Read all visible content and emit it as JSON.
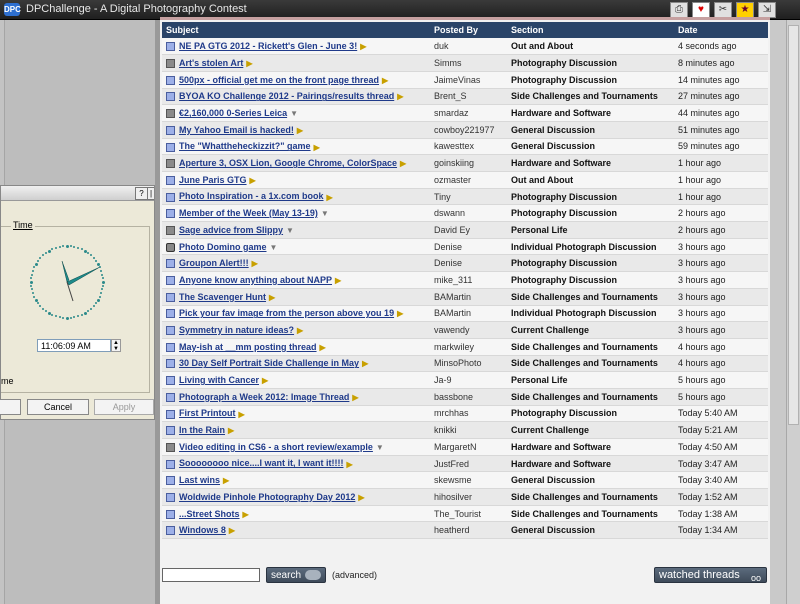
{
  "window": {
    "title": "DPChallenge - A Digital Photography Contest",
    "logo_text": "DPC"
  },
  "table": {
    "headers": {
      "subject": "Subject",
      "posted_by": "Posted By",
      "section": "Section",
      "date": "Date"
    },
    "rows": [
      {
        "subject": "NE PA GTG 2012 - Rickett's Glen - June 3!",
        "poster": "duk",
        "section": "Out and About",
        "date": "4 seconds ago",
        "icon": "blue",
        "arrow": "right"
      },
      {
        "subject": "Art's stolen Art",
        "poster": "Simms",
        "section": "Photography Discussion",
        "date": "8 minutes ago",
        "icon": "gray",
        "arrow": "right"
      },
      {
        "subject": "500px - official get me on the front page thread",
        "poster": "JaimeVinas",
        "section": "Photography Discussion",
        "date": "14 minutes ago",
        "icon": "blue",
        "arrow": "right"
      },
      {
        "subject": "BYOA KO Challenge 2012 - Pairings/results thread",
        "poster": "Brent_S",
        "section": "Side Challenges and Tournaments",
        "date": "27 minutes ago",
        "icon": "blue",
        "arrow": "right"
      },
      {
        "subject": "€2,160,000 0-Series Leica",
        "poster": "smardaz",
        "section": "Hardware and Software",
        "date": "44 minutes ago",
        "icon": "gray",
        "arrow": "down"
      },
      {
        "subject": "My Yahoo Email is hacked!",
        "poster": "cowboy221977",
        "section": "General Discussion",
        "date": "51 minutes ago",
        "icon": "blue",
        "arrow": "right"
      },
      {
        "subject": "The \"Whattheheckizzit?\" game",
        "poster": "kawesttex",
        "section": "General Discussion",
        "date": "59 minutes ago",
        "icon": "blue",
        "arrow": "right"
      },
      {
        "subject": "Aperture 3, OSX Lion, Google Chrome, ColorSpace",
        "poster": "goinskiing",
        "section": "Hardware and Software",
        "date": "1 hour ago",
        "icon": "gray",
        "arrow": "right"
      },
      {
        "subject": "June Paris GTG",
        "poster": "ozmaster",
        "section": "Out and About",
        "date": "1 hour ago",
        "icon": "blue",
        "arrow": "right"
      },
      {
        "subject": "Photo Inspiration - a 1x.com book",
        "poster": "Tiny",
        "section": "Photography Discussion",
        "date": "1 hour ago",
        "icon": "blue",
        "arrow": "right"
      },
      {
        "subject": "Member of the Week (May 13-19)",
        "poster": "dswann",
        "section": "Photography Discussion",
        "date": "2 hours ago",
        "icon": "blue",
        "arrow": "down"
      },
      {
        "subject": "Sage advice from Slippy",
        "poster": "David Ey",
        "section": "Personal Life",
        "date": "2 hours ago",
        "icon": "gray",
        "arrow": "down"
      },
      {
        "subject": "Photo Domino game",
        "poster": "Denise",
        "section": "Individual Photograph Discussion",
        "date": "3 hours ago",
        "icon": "camera",
        "arrow": "down"
      },
      {
        "subject": "Groupon Alert!!!",
        "poster": "Denise",
        "section": "Photography Discussion",
        "date": "3 hours ago",
        "icon": "blue",
        "arrow": "right"
      },
      {
        "subject": "Anyone know anything about NAPP",
        "poster": "mike_311",
        "section": "Photography Discussion",
        "date": "3 hours ago",
        "icon": "blue",
        "arrow": "right"
      },
      {
        "subject": "The Scavenger Hunt",
        "poster": "BAMartin",
        "section": "Side Challenges and Tournaments",
        "date": "3 hours ago",
        "icon": "blue",
        "arrow": "right"
      },
      {
        "subject": "Pick your fav image from the person above you 19",
        "poster": "BAMartin",
        "section": "Individual Photograph Discussion",
        "date": "3 hours ago",
        "icon": "blue",
        "arrow": "right"
      },
      {
        "subject": "Symmetry in nature ideas?",
        "poster": "vawendy",
        "section": "Current Challenge",
        "date": "3 hours ago",
        "icon": "blue",
        "arrow": "right"
      },
      {
        "subject": "May-ish at __mm posting thread",
        "poster": "markwiley",
        "section": "Side Challenges and Tournaments",
        "date": "4 hours ago",
        "icon": "blue",
        "arrow": "right"
      },
      {
        "subject": "30 Day Self Portrait Side Challenge in May",
        "poster": "MinsoPhoto",
        "section": "Side Challenges and Tournaments",
        "date": "4 hours ago",
        "icon": "blue",
        "arrow": "right"
      },
      {
        "subject": "Living with Cancer",
        "poster": "Ja-9",
        "section": "Personal Life",
        "date": "5 hours ago",
        "icon": "blue",
        "arrow": "right"
      },
      {
        "subject": "Photograph a Week 2012: Image Thread",
        "poster": "bassbone",
        "section": "Side Challenges and Tournaments",
        "date": "5 hours ago",
        "icon": "blue",
        "arrow": "right"
      },
      {
        "subject": "First Printout",
        "poster": "mrchhas",
        "section": "Photography Discussion",
        "date": "Today 5:40 AM",
        "icon": "blue",
        "arrow": "right"
      },
      {
        "subject": "In the Rain",
        "poster": "knikki",
        "section": "Current Challenge",
        "date": "Today 5:21 AM",
        "icon": "blue",
        "arrow": "right"
      },
      {
        "subject": "Video editing in CS6 - a short review/example",
        "poster": "MargaretN",
        "section": "Hardware and Software",
        "date": "Today 4:50 AM",
        "icon": "gray",
        "arrow": "down"
      },
      {
        "subject": "Soooooooo nice....I want it, I want it!!!!",
        "poster": "JustFred",
        "section": "Hardware and Software",
        "date": "Today 3:47 AM",
        "icon": "blue",
        "arrow": "right"
      },
      {
        "subject": "Last wins",
        "poster": "skewsme",
        "section": "General Discussion",
        "date": "Today 3:40 AM",
        "icon": "blue",
        "arrow": "right"
      },
      {
        "subject": "Woldwide Pinhole Photography Day 2012",
        "poster": "hihosilver",
        "section": "Side Challenges and Tournaments",
        "date": "Today 1:52 AM",
        "icon": "blue",
        "arrow": "right"
      },
      {
        "subject": "...Street Shots",
        "poster": "The_Tourist",
        "section": "Side Challenges and Tournaments",
        "date": "Today 1:38 AM",
        "icon": "blue",
        "arrow": "right"
      },
      {
        "subject": "Windows 8",
        "poster": "heatherd",
        "section": "General Discussion",
        "date": "Today 1:34 AM",
        "icon": "blue",
        "arrow": "right"
      }
    ]
  },
  "footer": {
    "search_label": "search",
    "advanced_label": "(advanced)",
    "watched_label": "watched threads",
    "watched_icon": "oo"
  },
  "dialog": {
    "help_label": "?",
    "close_label": "|",
    "group_label": "Time",
    "time_value": "11:06:09 AM",
    "partial_label": "me",
    "cancel_label": "Cancel",
    "apply_label": "Apply"
  },
  "colors": {
    "header_bg": "#2a4468",
    "link": "#1f3a8a"
  }
}
